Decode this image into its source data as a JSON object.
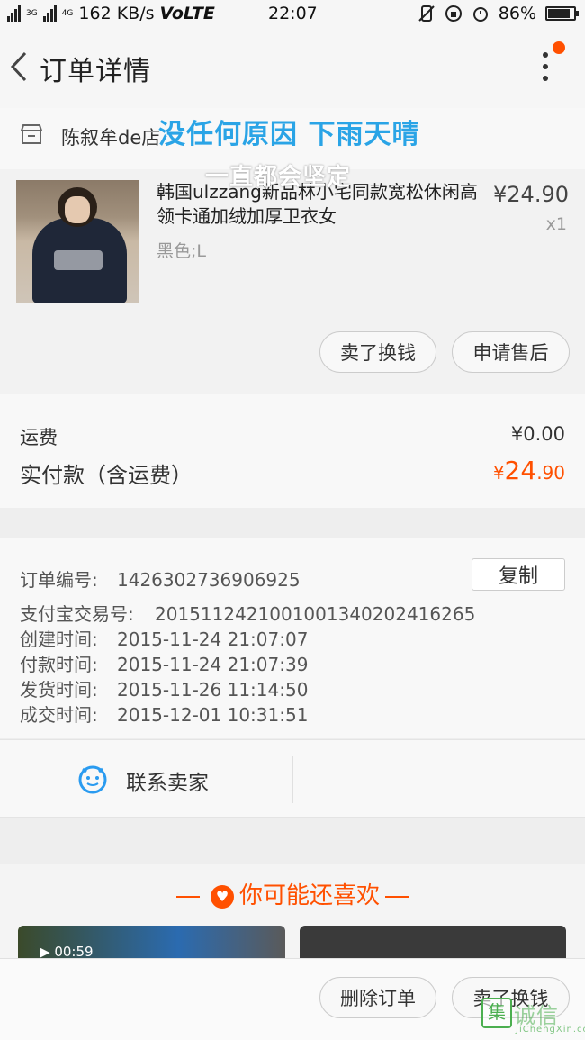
{
  "status_bar": {
    "net_labels": [
      "3G",
      "4G"
    ],
    "speed": "162 KB/s",
    "volte": "VoLTE",
    "time": "22:07",
    "battery": "86%",
    "battery_level": 0.86
  },
  "header": {
    "title": "订单详情"
  },
  "shop": {
    "name": "陈叙牟de店"
  },
  "overlay": {
    "line1": "没任何原因 下雨天晴",
    "line2": "一直都会坚定"
  },
  "product": {
    "name": "韩国ulzzang新品林小宅同款宽松休闲高领卡通加绒加厚卫衣女",
    "spec": "黑色;L",
    "price": "¥24.90",
    "qty": "x1",
    "btn_sell": "卖了换钱",
    "btn_after": "申请售后"
  },
  "fees": {
    "shipping_label": "运费",
    "shipping_value": "¥0.00",
    "paid_label": "实付款（含运费）",
    "paid_symbol": "¥",
    "paid_int": "24",
    "paid_dec": ".90"
  },
  "order_info": {
    "order_no_label": "订单编号:",
    "order_no": "1426302736906925",
    "copy_label": "复制",
    "alipay_label": "支付宝交易号:",
    "alipay_no": "2015112421001001340202416265",
    "created_label": "创建时间:",
    "created": "2015-11-24 21:07:07",
    "paid_label": "付款时间:",
    "paid": "2015-11-24 21:07:39",
    "shipped_label": "发货时间:",
    "shipped": "2015-11-26 11:14:50",
    "done_label": "成交时间:",
    "done": "2015-12-01 10:31:51"
  },
  "contact": {
    "label": "联系卖家"
  },
  "recommend": {
    "title": "你可能还喜欢",
    "card1_duration": "00:59"
  },
  "bottom_bar": {
    "delete_label": "删除订单",
    "sell_label": "卖了换钱"
  },
  "watermark": {
    "mark": "集",
    "cn": "诚信",
    "en": "JiChengXin.com"
  },
  "colors": {
    "accent": "#ff5000",
    "overlay_blue": "#2aa4e6",
    "contact_blue": "#2a9bf0"
  }
}
